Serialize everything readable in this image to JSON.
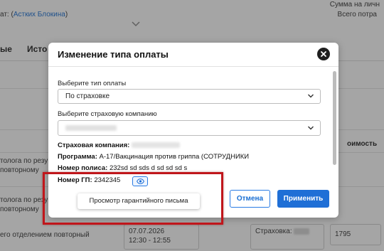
{
  "background": {
    "patient_prefix": "ат: (",
    "patient_name": "Астких Блокина",
    "patient_suffix": ")",
    "sum_label": "Сумма на личн",
    "total_label": "Всего потра",
    "tabs": [
      "ые",
      "Исто"
    ],
    "column_header": "оимость",
    "rows": [
      {
        "line1": "толога по резу",
        "line2": "повторному"
      },
      {
        "line1": "толога по резу",
        "line2": "повторному"
      },
      {
        "line1": "его отделением повторный",
        "line2": ""
      }
    ],
    "date_cell": {
      "date": "07.07.2026",
      "time": "12:30 - 12:55"
    },
    "insurance_cell_label": "Страховка:",
    "amount": "1795"
  },
  "modal": {
    "title": "Изменение типа оплаты",
    "payment_type": {
      "label": "Выберите тип оплаты",
      "value": "По страховке"
    },
    "insurance_company": {
      "label": "Выберите страховую компанию"
    },
    "info": {
      "company_label": "Страховая компания:",
      "program_label": "Программа:",
      "program_value": "А-17/Вакцинация против гриппа (СОТРУДНИКИ",
      "policy_label": "Номер полиса:",
      "policy_value": "232sd sd sds d sd sd sd s",
      "gp_label": "Номер ГП:",
      "gp_value": "2342345"
    },
    "tooltip": "Просмотр гарантийного письма",
    "cancel_label": "Отмена",
    "apply_label": "Применить"
  },
  "icons": {
    "close": "close-icon",
    "chevron": "chevron-down-icon",
    "view": "eye-icon"
  },
  "colors": {
    "accent": "#1f6fd6",
    "highlight": "#c0161b",
    "link": "#1a6fd3"
  }
}
